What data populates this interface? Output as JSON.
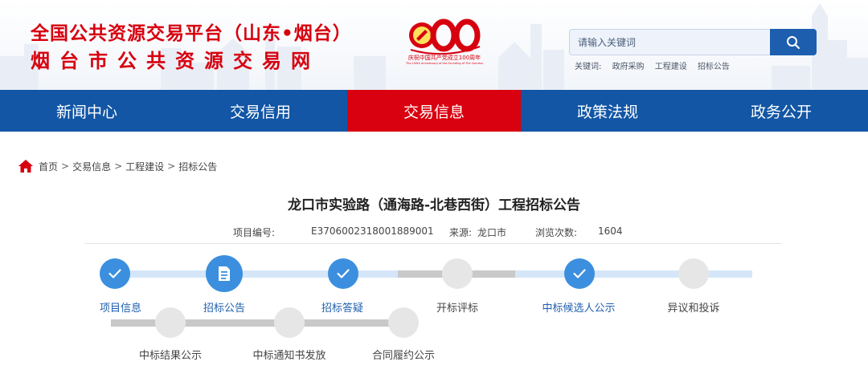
{
  "header": {
    "title_line1": "全国公共资源交易平台（山东•烟台）",
    "title_line2": "烟台市公共资源交易网",
    "logo_text": "庆祝中国共产党成立100周年",
    "logo_subtext": "The 100th Anniversary of the Founding of The Communist Party of China",
    "logo_number": "100"
  },
  "search": {
    "placeholder": "请输入关键词",
    "keywords_label": "关键词:",
    "keywords": [
      "政府采购",
      "工程建设",
      "招标公告"
    ]
  },
  "nav": {
    "items": [
      "新闻中心",
      "交易信用",
      "交易信息",
      "政策法规",
      "政务公开"
    ],
    "active_index": 2
  },
  "breadcrumb": {
    "items": [
      "首页",
      "交易信息",
      "工程建设",
      "招标公告"
    ],
    "separator": ">"
  },
  "article": {
    "title": "龙口市实验路（通海路-北巷西街）工程招标公告",
    "project_no_label": "项目编号:",
    "project_no": "E3706002318001889001",
    "source_label": "来源:",
    "source": "龙口市",
    "views_label": "浏览次数:",
    "views": "1604"
  },
  "steps": {
    "row1": [
      {
        "label": "项目信息",
        "status": "done",
        "icon": "check-icon"
      },
      {
        "label": "招标公告",
        "status": "current",
        "icon": "document-icon"
      },
      {
        "label": "招标答疑",
        "status": "done",
        "icon": "check-icon"
      },
      {
        "label": "开标评标",
        "status": "pending",
        "icon": ""
      },
      {
        "label": "中标候选人公示",
        "status": "done",
        "icon": "check-icon"
      },
      {
        "label": "异议和投诉",
        "status": "pending",
        "icon": ""
      }
    ],
    "row2": [
      {
        "label": "中标结果公示",
        "status": "pending"
      },
      {
        "label": "中标通知书发放",
        "status": "pending"
      },
      {
        "label": "合同履约公示",
        "status": "pending"
      }
    ]
  },
  "colors": {
    "brand_red": "#d7000f",
    "nav_blue": "#1256a5",
    "step_blue": "#3b8fde",
    "track_blue": "#d5e6f8",
    "track_gray": "#c9c9c9"
  }
}
